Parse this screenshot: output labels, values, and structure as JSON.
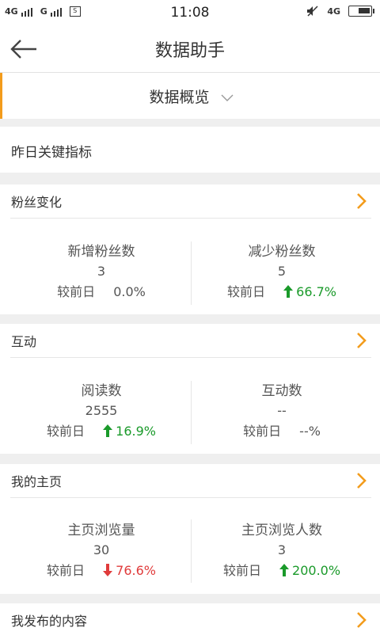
{
  "status_bar": {
    "network1": "4G",
    "network2": "G",
    "time": "11:08",
    "network3": "4G",
    "sim_icon": "S"
  },
  "header": {
    "title": "数据助手",
    "back_icon": "arrow-left-icon"
  },
  "overview": {
    "label": "数据概览",
    "chevron_icon": "chevron-down-icon"
  },
  "key_metrics_title": "昨日关键指标",
  "sections": [
    {
      "title": "粉丝变化",
      "metrics": [
        {
          "name": "新增粉丝数",
          "value": "3",
          "compare_label": "较前日",
          "change": "0.0%",
          "trend": "none"
        },
        {
          "name": "减少粉丝数",
          "value": "5",
          "compare_label": "较前日",
          "change": "66.7%",
          "trend": "up"
        }
      ]
    },
    {
      "title": "互动",
      "metrics": [
        {
          "name": "阅读数",
          "value": "2555",
          "compare_label": "较前日",
          "change": "16.9%",
          "trend": "up"
        },
        {
          "name": "互动数",
          "value": "--",
          "compare_label": "较前日",
          "change": "--%",
          "trend": "none"
        }
      ]
    },
    {
      "title": "我的主页",
      "metrics": [
        {
          "name": "主页浏览量",
          "value": "30",
          "compare_label": "较前日",
          "change": "76.6%",
          "trend": "down"
        },
        {
          "name": "主页浏览人数",
          "value": "3",
          "compare_label": "较前日",
          "change": "200.0%",
          "trend": "up"
        }
      ]
    },
    {
      "title": "我发布的内容",
      "metrics": []
    }
  ],
  "colors": {
    "accent": "#f39c1c",
    "up": "#1a9a2a",
    "down": "#e03b3b"
  }
}
